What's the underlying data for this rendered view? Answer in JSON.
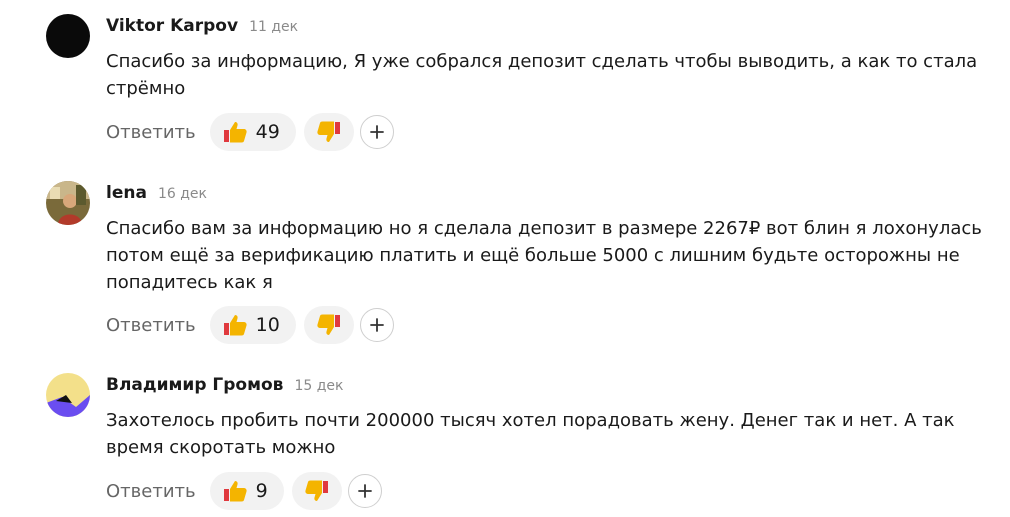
{
  "comments": [
    {
      "author": "Viktor Karpov",
      "date": "11 дек",
      "text": "Спасибо за информацию, Я уже собрался депозит сделать чтобы выводить, а как то стала стрёмно",
      "reply_label": "Ответить",
      "likes": "49",
      "avatar": "black-circle"
    },
    {
      "author": "lena",
      "date": "16 дек",
      "text": "Спасибо вам за информацию но я сделала депозит в размере 2267₽ вот блин я лохонулась потом ещё за верификацию платить и ещё больше 5000 с лишним будьте осторожны не попадитесь как я",
      "reply_label": "Ответить",
      "likes": "10",
      "avatar": "photo"
    },
    {
      "author": "Владимир Громов",
      "date": "15 дек",
      "text": "Захотелось пробить почти 200000 тысяч хотел порадовать жену. Денег так и нет. А так время скоротать можно",
      "reply_label": "Ответить",
      "likes": "9",
      "avatar": "yellow-purple"
    }
  ],
  "icons": {
    "like": "thumbs-up-icon",
    "dislike": "thumbs-down-icon",
    "add_reaction": "plus-icon"
  },
  "colors": {
    "reaction_yellow": "#f4b400",
    "reaction_red": "#e0393e",
    "pill_bg": "#f2f2f2",
    "muted_text": "#666666"
  }
}
